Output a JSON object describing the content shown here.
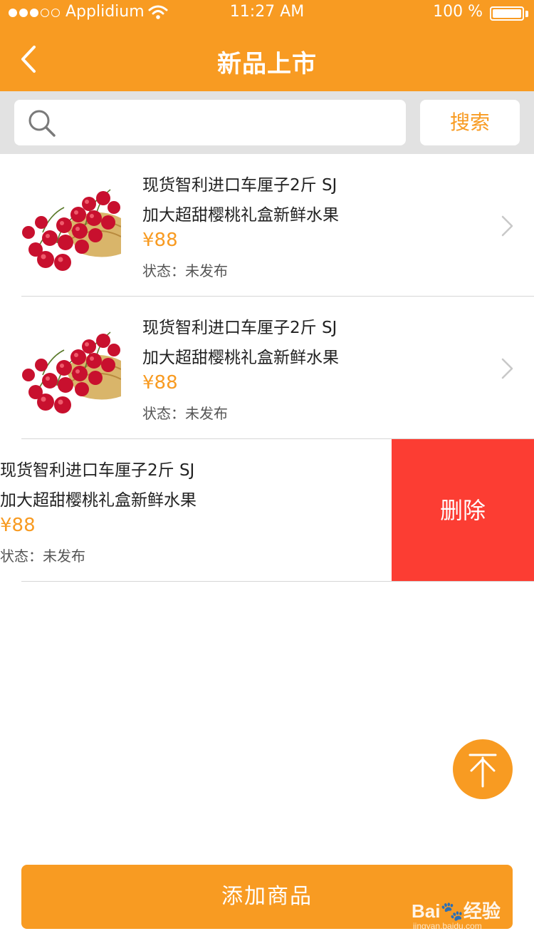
{
  "status_bar": {
    "carrier": "Applidium",
    "time": "11:27 AM",
    "battery": "100 %"
  },
  "nav": {
    "title": "新品上市",
    "back_icon": "chevron-left-icon"
  },
  "search": {
    "placeholder": "",
    "value": "",
    "button_label": "搜索",
    "icon": "search-icon"
  },
  "items": [
    {
      "title_line1": "现货智利进口车厘子2斤 SJ",
      "title_line2": "加大超甜樱桃礼盒新鲜水果",
      "price": "¥88",
      "status": "状态：未发布",
      "image": "cherry-photo"
    },
    {
      "title_line1": "现货智利进口车厘子2斤 SJ",
      "title_line2": "加大超甜樱桃礼盒新鲜水果",
      "price": "¥88",
      "status": "状态：未发布",
      "image": "cherry-photo"
    },
    {
      "title_line1": "现货智利进口车厘子2斤 SJ",
      "title_line2": "加大超甜樱桃礼盒新鲜水果",
      "price": "¥88",
      "status": "状态：未发布",
      "image": "cherry-photo",
      "delete_label": "删除"
    }
  ],
  "scroll_top_icon": "arrow-up-to-top-icon",
  "add_button": {
    "label": "添加商品"
  },
  "watermark": {
    "text": "Bai🐾经验",
    "sub": "jingyan.baidu.com"
  },
  "colors": {
    "accent": "#f89b22",
    "delete": "#fc3d33",
    "search_bg": "#e2e2e2",
    "divider": "#d6d6d6"
  }
}
